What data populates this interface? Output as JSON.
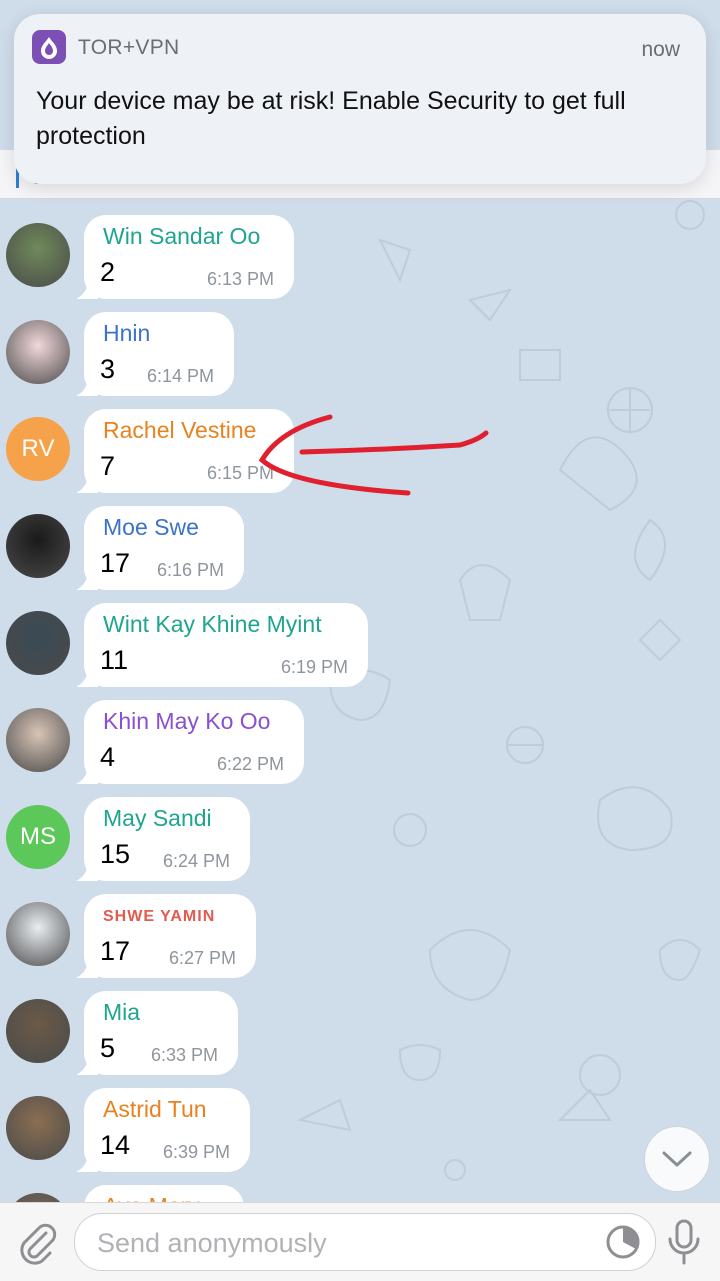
{
  "notification": {
    "app_name": "TOR+VPN",
    "time": "now",
    "message": "Your device may be at risk! Enable Security to get full protection"
  },
  "messages": [
    {
      "sender": "Win Sandar Oo",
      "text": "2",
      "time": "6:13 PM",
      "color": "#1fa58f",
      "avatar": "photo",
      "initials": ""
    },
    {
      "sender": "Hnin",
      "text": "3",
      "time": "6:14 PM",
      "color": "#3b73c8",
      "avatar": "photo",
      "initials": ""
    },
    {
      "sender": "Rachel Vestine",
      "text": "7",
      "time": "6:15 PM",
      "color": "#e8811f",
      "avatar": "initials",
      "initials": "RV",
      "avatar_color": "#f5a24a"
    },
    {
      "sender": "Moe Swe",
      "text": "17",
      "time": "6:16 PM",
      "color": "#3b73c8",
      "avatar": "photo",
      "initials": ""
    },
    {
      "sender": "Wint Kay Khine Myint",
      "text": "11",
      "time": "6:19 PM",
      "color": "#1fa58f",
      "avatar": "photo",
      "initials": ""
    },
    {
      "sender": "Khin May Ko Oo",
      "text": "4",
      "time": "6:22 PM",
      "color": "#8a4fd0",
      "avatar": "photo",
      "initials": ""
    },
    {
      "sender": "May Sandi",
      "text": "15",
      "time": "6:24 PM",
      "color": "#1fa58f",
      "avatar": "initials",
      "initials": "MS",
      "avatar_color": "#5cc85a"
    },
    {
      "sender": "SHWE YAMIN",
      "text": "17",
      "time": "6:27 PM",
      "color": "#e35a4e",
      "avatar": "photo",
      "initials": ""
    },
    {
      "sender": "Mia",
      "text": "5",
      "time": "6:33 PM",
      "color": "#1fa58f",
      "avatar": "photo",
      "initials": ""
    },
    {
      "sender": "Astrid Tun",
      "text": "14",
      "time": "6:39 PM",
      "color": "#e8811f",
      "avatar": "photo",
      "initials": ""
    },
    {
      "sender": "Aye Mary",
      "text": "",
      "time": "",
      "color": "#e8811f",
      "avatar": "photo",
      "initials": ""
    }
  ],
  "composer": {
    "placeholder": "Send anonymously"
  },
  "icons": {
    "attach": "paperclip-icon",
    "timer": "timer-icon",
    "mic": "microphone-icon",
    "scroll": "chevron-down-icon",
    "notification_app": "tor-onion-icon"
  },
  "annotation": {
    "arrow_color": "#e0202e"
  }
}
